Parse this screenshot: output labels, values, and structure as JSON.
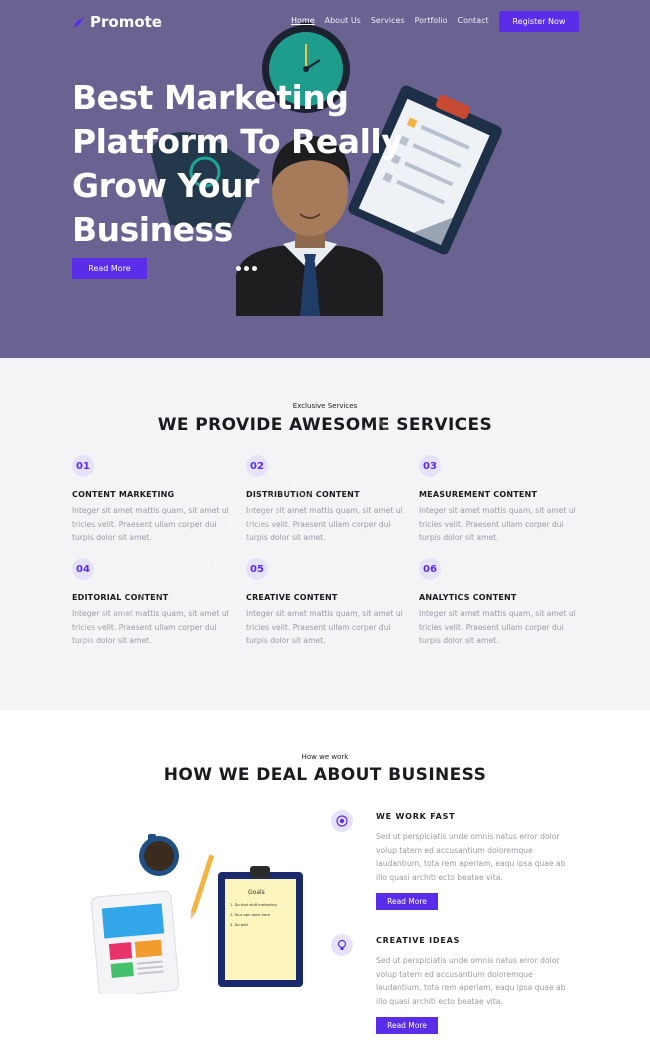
{
  "brand": {
    "name": "Promote",
    "accent": "#5a2ee8",
    "hero_bg": "#6a6392"
  },
  "nav": {
    "items": [
      {
        "label": "Home"
      },
      {
        "label": "About Us"
      },
      {
        "label": "Services"
      },
      {
        "label": "Portfolio"
      },
      {
        "label": "Contact"
      }
    ],
    "register_label": "Register Now"
  },
  "hero": {
    "title_lines": [
      "Best Marketing",
      "Platform To Really",
      "Grow Your",
      "Business"
    ],
    "button_label": "Read More",
    "slide_dots": 3
  },
  "services": {
    "kicker": "Exclusive Services",
    "title": "WE PROVIDE AWESOME SERVICES",
    "items": [
      {
        "num": "01",
        "title": "CONTENT MARKETING",
        "text": "Integer sit amet mattis quam, sit amet ul tricies velit. Praesent ullam corper dui turpis dolor sit amet."
      },
      {
        "num": "02",
        "title": "DISTRIBUTION CONTENT",
        "text": "Integer sit amet mattis quam, sit amet ul tricies velit. Praesent ullam corper dui turpis dolor sit amet."
      },
      {
        "num": "03",
        "title": "MEASUREMENT CONTENT",
        "text": "Integer sit amet mattis quam, sit amet ul tricies velit. Praesent ullam corper dui turpis dolor sit amet."
      },
      {
        "num": "04",
        "title": "EDITORIAL CONTENT",
        "text": "Integer sit amet mattis quam, sit amet ul tricies velit. Praesent ullam corper dui turpis dolor sit amet."
      },
      {
        "num": "05",
        "title": "CREATIVE CONTENT",
        "text": "Integer sit amet mattis quam, sit amet ul tricies velit. Praesent ullam corper dui turpis dolor sit amet."
      },
      {
        "num": "06",
        "title": "ANALYTICS CONTENT",
        "text": "Integer sit amet mattis quam, sit amet ul tricies velit. Praesent ullam corper dui turpis dolor sit amet."
      }
    ]
  },
  "how": {
    "kicker": "How we work",
    "title": "HOW WE DEAL ABOUT BUSINESS",
    "items": [
      {
        "icon": "target-icon",
        "title": "WE WORK FAST",
        "text": "Sed ut perspiciatis unde omnis natus error dolor volup tatem ed accusantium doloremque laudantium, tota rem aperiam, eaqu ipsa quae ab illo quasi architi ecto beatae vita.",
        "button_label": "Read More"
      },
      {
        "icon": "lightbulb-icon",
        "title": "CREATIVE IDEAS",
        "text": "Sed ut perspiciatis unde omnis natus error dolor volup tatem ed accusantium doloremque laudantium, tota rem aperiam, eaqu ipsa quae ab illo quasi architi ecto beatae vita.",
        "button_label": "Read More"
      }
    ],
    "clipboard_heading": "Goals",
    "clipboard_lines": [
      "1. Do that stuff marketing",
      "2. Your own work here",
      "3. Do well"
    ]
  },
  "watermark": "WWW.DOWNDEMO.COM"
}
